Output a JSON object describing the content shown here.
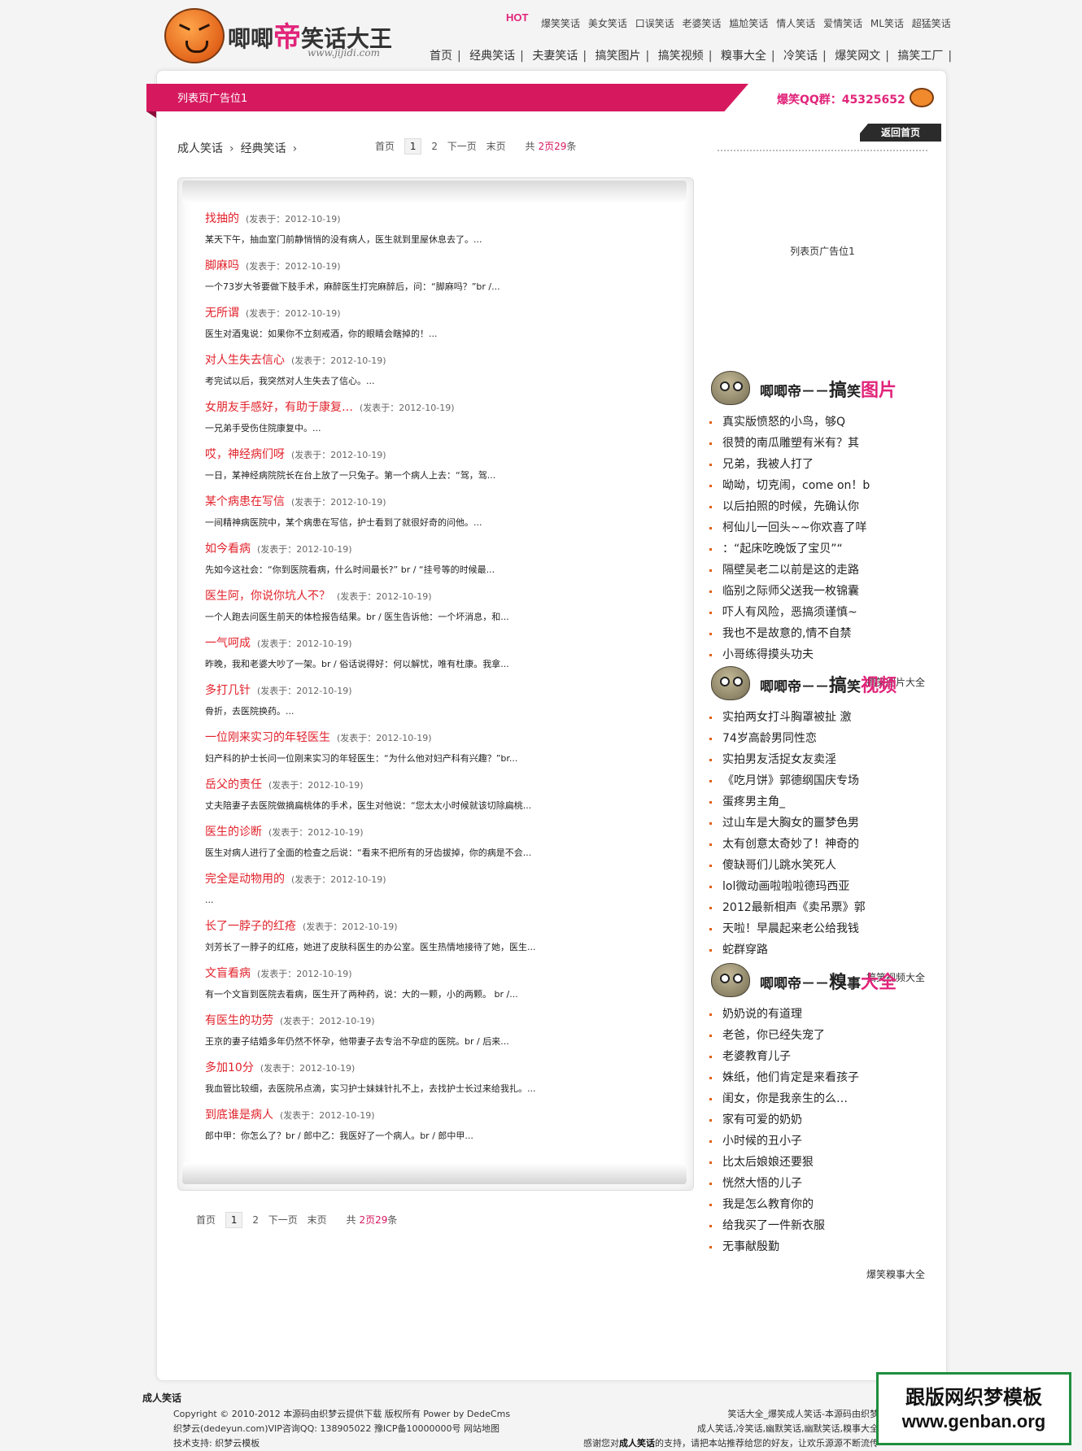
{
  "header": {
    "logo_text_prefix": "唧唧",
    "logo_text_red": "帝",
    "logo_text_suffix": "笑话大王",
    "logo_url": "www.jijidi.com",
    "hot_badge": "HOT",
    "hot_links": [
      "爆笑笑话",
      "美女笑话",
      "口误笑话",
      "老婆笑话",
      "尴尬笑话",
      "情人笑话",
      "爱情笑话",
      "ML笑话",
      "超猛笑话"
    ],
    "nav": [
      "首页",
      "经典笑话",
      "夫妻笑话",
      "搞笑图片",
      "搞笑视频",
      "糗事大全",
      "冷笑话",
      "爆笑网文",
      "搞笑工厂"
    ]
  },
  "ad_banner": {
    "label": "列表页广告位1",
    "qq_group": "爆笑QQ群：45325652"
  },
  "breadcrumb": [
    "成人笑话",
    "经典笑话"
  ],
  "pager": {
    "first": "首页",
    "current": "1",
    "page2": "2",
    "next": "下一页",
    "last": "末页",
    "total_prefix": "共",
    "total_pages": "2",
    "pages_unit": "页",
    "total_items": "29",
    "items_unit": "条"
  },
  "jokes": [
    {
      "title": "找抽的",
      "date": "(发表于：2012-10-19)",
      "summary": "某天下午，抽血室门前静悄悄的没有病人，医生就到里屋休息去了。..."
    },
    {
      "title": "脚麻吗",
      "date": "(发表于：2012-10-19)",
      "summary": "一个73岁大爷要做下肢手术，麻醉医生打完麻醉后，问：“脚麻吗？”br /..."
    },
    {
      "title": "无所谓",
      "date": "(发表于：2012-10-19)",
      "summary": "医生对酒鬼说：如果你不立刻戒酒，你的眼睛会瞎掉的！..."
    },
    {
      "title": "对人生失去信心",
      "date": "(发表于：2012-10-19)",
      "summary": "考完试以后，我突然对人生失去了信心。..."
    },
    {
      "title": "女朋友手感好，有助于康复…",
      "date": "(发表于：2012-10-19)",
      "summary": "一兄弟手受伤住院康复中。..."
    },
    {
      "title": "哎，神经病们呀",
      "date": "(发表于：2012-10-19)",
      "summary": "一日，某神经病院院长在台上放了一只兔子。第一个病人上去：“驾，驾..."
    },
    {
      "title": "某个病患在写信",
      "date": "(发表于：2012-10-19)",
      "summary": "一间精神病医院中，某个病患在写信，护士看到了就很好奇的问他。..."
    },
    {
      "title": "如今看病",
      "date": "(发表于：2012-10-19)",
      "summary": "先如今这社会：“你到医院看病，什么时间最长?” br / “挂号等的时候最..."
    },
    {
      "title": "医生阿，你说你坑人不？",
      "date": "(发表于：2012-10-19)",
      "summary": "一个人跑去问医生前天的体检报告结果。br / 医生告诉他：一个坏消息，和..."
    },
    {
      "title": "一气呵成",
      "date": "(发表于：2012-10-19)",
      "summary": "昨晚，我和老婆大吵了一架。br / 俗话说得好：何以解忧，唯有杜康。我拿..."
    },
    {
      "title": "多打几针",
      "date": "(发表于：2012-10-19)",
      "summary": "骨折，去医院换药。..."
    },
    {
      "title": "一位刚来实习的年轻医生",
      "date": "(发表于：2012-10-19)",
      "summary": "妇产科的护士长问一位刚来实习的年轻医生：“为什么他对妇产科有兴趣？”br..."
    },
    {
      "title": "岳父的责任",
      "date": "(发表于：2012-10-19)",
      "summary": "丈夫陪妻子去医院做摘扁桃体的手术，医生对他说：“您太太小时候就该切除扁桃..."
    },
    {
      "title": "医生的诊断",
      "date": "(发表于：2012-10-19)",
      "summary": "医生对病人进行了全面的检查之后说：“看来不把所有的牙齿拔掉，你的病是不会..."
    },
    {
      "title": "完全是动物用的",
      "date": "(发表于：2012-10-19)",
      "summary": "..."
    },
    {
      "title": "长了一脖子的红疮",
      "date": "(发表于：2012-10-19)",
      "summary": "刘芳长了一脖子的红疮，她进了皮肤科医生的办公室。医生热情地接待了她，医生..."
    },
    {
      "title": "文盲看病",
      "date": "(发表于：2012-10-19)",
      "summary": "有一个文盲到医院去看病，医生开了两种药，说：大的一颗，小的两颗。 br /..."
    },
    {
      "title": "有医生的功劳",
      "date": "(发表于：2012-10-19)",
      "summary": "王京的妻子结婚多年仍然不怀孕，他带妻子去专治不孕症的医院。br / 后来..."
    },
    {
      "title": "多加10分",
      "date": "(发表于：2012-10-19)",
      "summary": "我血管比较细，去医院吊点滴，实习护士妹妹针扎不上，去找护士长过来给我扎。..."
    },
    {
      "title": "到底谁是病人",
      "date": "(发表于：2012-10-19)",
      "summary": "郎中甲：你怎么了？br / 郎中乙：我医好了一个病人。br / 郎中甲..."
    }
  ],
  "sidebar": {
    "back_home": "返回首页",
    "ad_label": "列表页广告位1",
    "sections": [
      {
        "brand": "唧唧帝",
        "dash": "－－",
        "t1": "搞",
        "t2": "笑",
        "t3": "图片",
        "items": [
          "真实版愤怒的小鸟，够Q",
          "很赞的南瓜雕塑有米有？其",
          "兄弟，我被人打了",
          "呦呦，切克闹，come on！b",
          "以后拍照的时候，先确认你",
          "柯仙儿一回头~~你欢喜了咩",
          "：“起床吃晚饭了宝贝”“",
          "隔壁吴老二以前是这的走路",
          "临别之际师父送我一枚锦囊",
          "吓人有风险，恶搞须谨慎~",
          "我也不是故意的,情不自禁",
          "小哥练得摸头功夫"
        ],
        "more": "搞笑图片大全"
      },
      {
        "brand": "唧唧帝",
        "dash": "－－",
        "t1": "搞",
        "t2": "笑",
        "t3": "视频",
        "items": [
          "实拍两女打斗胸罩被扯 激",
          "74岁高龄男同性恋",
          "实拍男友活捉女友卖淫",
          "《吃月饼》郭德纲国庆专场",
          "蛋疼男主角_",
          "过山车是大胸女的噩梦色男",
          "太有创意太奇妙了！神奇的",
          "傻缺哥们儿跳水笑死人",
          "lol微动画啦啦啦德玛西亚",
          "2012最新相声《卖吊票》郭",
          "天啦！早晨起来老公给我钱",
          "蛇群穿路"
        ],
        "more": "搞笑视频大全"
      },
      {
        "brand": "唧唧帝",
        "dash": "－－",
        "t1": "糗",
        "t2": "事",
        "t3": "大全",
        "items": [
          "奶奶说的有道理",
          "老爸，你已经失宠了",
          "老婆教育儿子",
          "姝纸，他们肯定是来看孩子",
          "闺女，你是我亲生的么…",
          "家有可爱的奶奶",
          "小时候的丑小子",
          "比太后娘娘还要狠",
          "恍然大悟的儿子",
          "我是怎么教育你的",
          "给我买了一件新衣服",
          "无事献殷勤"
        ],
        "more": "爆笑糗事大全"
      }
    ]
  },
  "footer": {
    "site_name": "成人笑话",
    "copy1": "Copyright © 2010-2012 本源码由织梦云提供下载 版权所有 Power by DedeCms",
    "copy2": "织梦云(dedeyun.com)VIP咨询QQ: 138905022 豫ICP备10000000号 网站地图",
    "copy3": "技术支持: 织梦云模板",
    "right1": "笑话大全_爆笑成人笑话-本源码由织梦",
    "right2": "成人笑话,冷笑话,幽默笑话,幽默笑话,糗事大全",
    "right3_pre": "感谢您对",
    "right3_bold": "成人笑话",
    "right3_post": "的支持，请把本站推荐给您的好友，让欢乐源源不断流传"
  },
  "badge": {
    "title": "跟版网织梦模板",
    "url": "www.genban.org"
  },
  "colors": {
    "accent_pink": "#d6195e",
    "title_red": "#e1222b",
    "badge_green": "#1e8e3e"
  }
}
